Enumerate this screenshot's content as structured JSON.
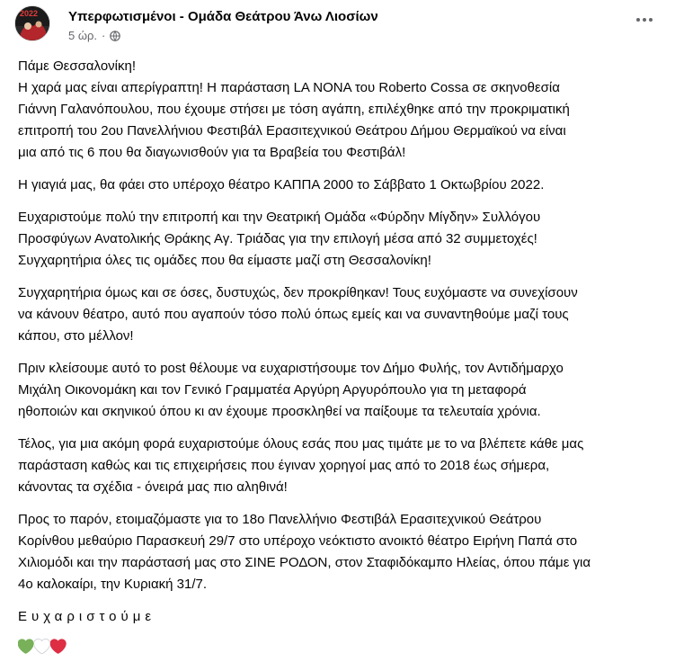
{
  "post": {
    "author": "Υπερφωτισμένοι - Ομάδα Θεάτρου Άνω Λιοσίων",
    "avatar_badge": "2022",
    "time": "5 ώρ.",
    "separator": "·",
    "privacy_icon": "globe-icon",
    "more_icon": "more-dots-icon",
    "paragraphs": [
      {
        "lines": [
          "Πάμε Θεσσαλονίκη!",
          "Η χαρά μας είναι απερίγραπτη! Η παράσταση LA NONA του Roberto Cossa σε σκηνοθεσία",
          "Γιάννη Γαλανόπουλου, που έχουμε στήσει με τόση αγάπη, επιλέχθηκε από την προκριματική",
          "επιτροπή του 2ου Πανελλήνιου Φεστιβάλ Ερασιτεχνικού Θεάτρου Δήμου Θερμαϊκού να είναι",
          "μια από τις 6 που θα διαγωνισθούν για τα Βραβεία του Φεστιβάλ!"
        ]
      },
      {
        "lines": [
          "Η γιαγιά μας, θα φάει στο υπέροχο θέατρο ΚΑΠΠΑ 2000 το Σάββατο 1 Οκτωβρίου 2022."
        ]
      },
      {
        "lines": [
          "Ευχαριστούμε πολύ την επιτροπή και την Θεατρική Ομάδα «Φύρδην Μίγδην» Συλλόγου",
          "Προσφύγων Ανατολικής Θράκης Αγ. Τριάδας για την επιλογή μέσα από 32 συμμετοχές!",
          "Συγχαρητήρια όλες τις ομάδες που θα είμαστε μαζί στη Θεσσαλονίκη!"
        ]
      },
      {
        "lines": [
          "Συγχαρητήρια όμως και σε όσες, δυστυχώς, δεν προκρίθηκαν! Τους ευχόμαστε να συνεχίσουν",
          "να κάνουν θέατρο, αυτό που αγαπούν τόσο πολύ όπως εμείς και να συναντηθούμε μαζί τους",
          "κάπου, στο μέλλον!"
        ]
      },
      {
        "lines": [
          "Πριν κλείσουμε αυτό το post θέλουμε να ευχαριστήσουμε τον Δήμο Φυλής, τον Αντιδήμαρχο",
          "Μιχάλη Οικονομάκη και τον Γενικό Γραμματέα Αργύρη Αργυρόπουλο για τη μεταφορά",
          "ηθοποιών και σκηνικού όπου κι αν έχουμε προσκληθεί να παίξουμε τα τελευταία χρόνια."
        ]
      },
      {
        "lines": [
          "Τέλος, για μια ακόμη φορά ευχαριστούμε όλους εσάς που μας τιμάτε με το να βλέπετε κάθε μας",
          "παράσταση καθώς και τις επιχειρήσεις που έγιναν χορηγοί μας  από το 2018 έως σήμερα,",
          "κάνοντας τα σχέδια - όνειρά μας πιο αληθινά!"
        ]
      },
      {
        "lines": [
          "Προς το παρόν, ετοιμαζόμαστε για το 18ο Πανελλήνιο Φεστιβάλ Ερασιτεχνικού Θεάτρου",
          "Κορίνθου μεθαύριο Παρασκευή 29/7 στο υπέροχο νεόκτιστο ανοικτό θέατρο Ειρήνη Παπά στο",
          "Χιλιομόδι και την παράστασή μας στο ΣΙΝΕ ΡΟΔΟΝ, στον Σταφιδόκαμπο Ηλείας, όπου πάμε για",
          "4ο καλοκαίρι, την Κυριακή 31/7."
        ]
      }
    ],
    "signoff": "Ευχαριστούμε",
    "emojis": [
      {
        "name": "green-heart-icon",
        "color": "#78b159"
      },
      {
        "name": "white-heart-icon",
        "color": "#ffffff"
      },
      {
        "name": "red-heart-icon",
        "color": "#dd2e44"
      }
    ]
  },
  "colors": {
    "text": "#050505",
    "secondary": "#65676b"
  }
}
